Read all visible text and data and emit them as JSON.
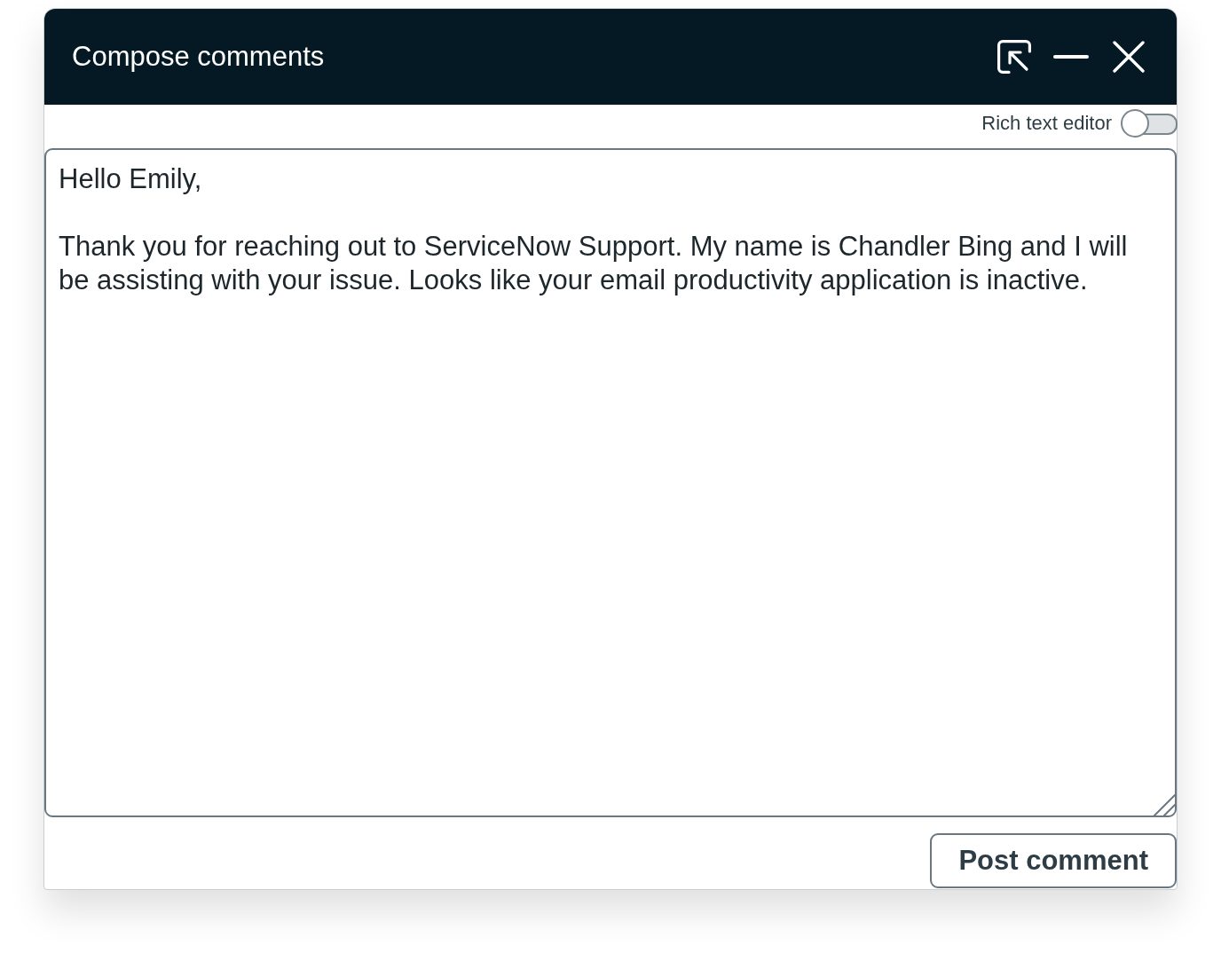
{
  "window": {
    "title": "Compose comments"
  },
  "rich_text_editor": {
    "label": "Rich text editor",
    "on": false
  },
  "comment_field": {
    "value": "Hello Emily,\n\nThank you for reaching out to ServiceNow Support. My name is Chandler Bing and I will be assisting with your issue. Looks like your email productivity application is inactive."
  },
  "post_button": {
    "label": "Post comment"
  }
}
